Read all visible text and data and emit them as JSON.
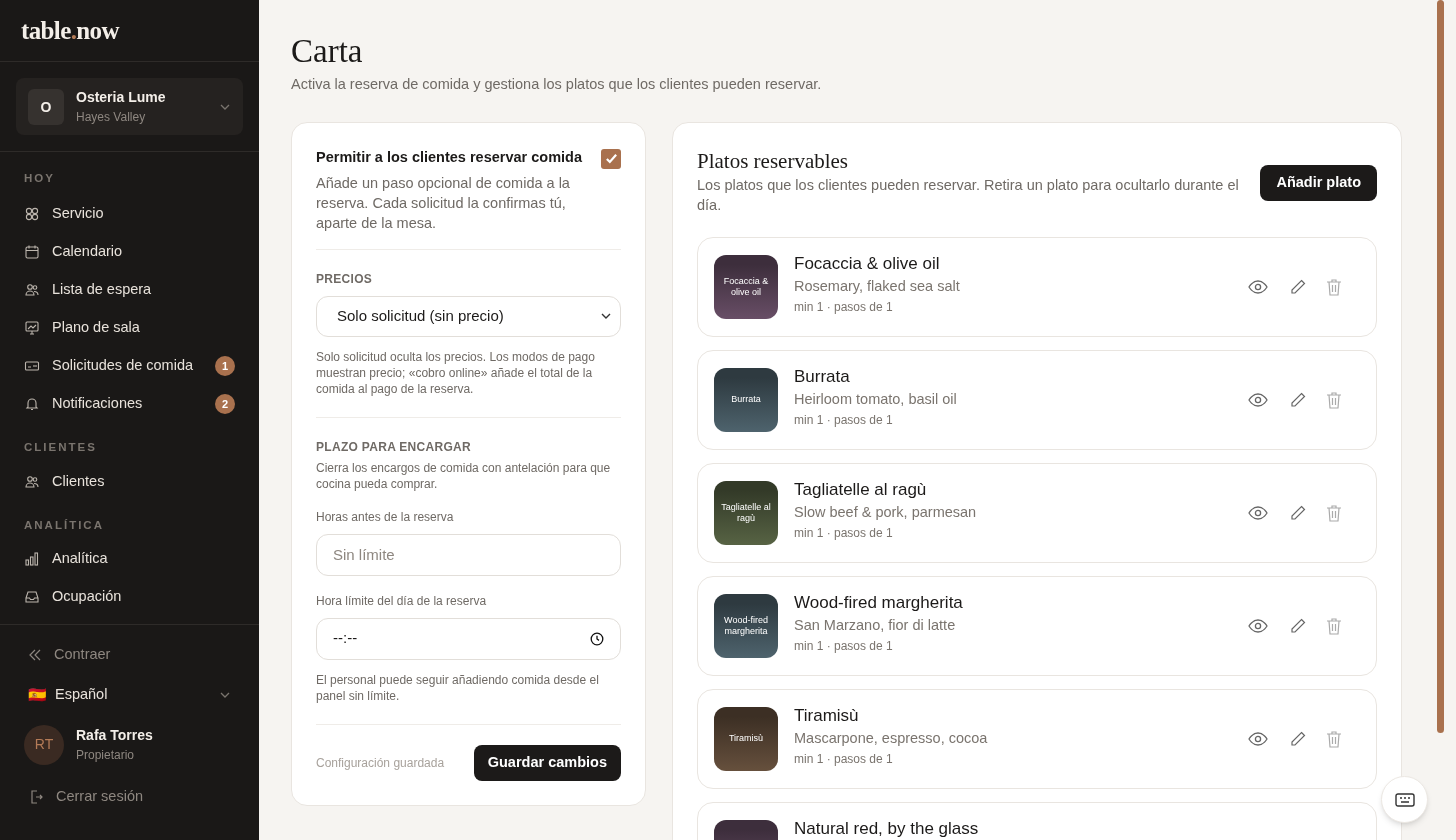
{
  "logo": {
    "name": "table",
    "separator": ".",
    "suffix": "now"
  },
  "venue": {
    "initial": "O",
    "name": "Osteria Lume",
    "area": "Hayes Valley"
  },
  "nav_sections": [
    {
      "heading": "HOY",
      "items": [
        {
          "label": "Servicio",
          "selected": false
        },
        {
          "label": "Calendario",
          "selected": false
        },
        {
          "label": "Lista de espera",
          "selected": false
        },
        {
          "label": "Plano de sala",
          "selected": false
        },
        {
          "label": "Solicitudes de comida",
          "selected": false,
          "badge": "1"
        },
        {
          "label": "Notificaciones",
          "selected": false,
          "badge": "2"
        }
      ]
    },
    {
      "heading": "CLIENTES",
      "items": [
        {
          "label": "Clientes",
          "selected": false
        }
      ]
    },
    {
      "heading": "ANALÍTICA",
      "items": [
        {
          "label": "Analítica",
          "selected": false
        },
        {
          "label": "Ocupación",
          "selected": false
        }
      ]
    }
  ],
  "collapse": "Contraer",
  "language": {
    "flag": "🇪🇸",
    "label": "Español"
  },
  "user": {
    "initials": "RT",
    "name": "Rafa Torres",
    "role": "Propietario"
  },
  "logout": "Cerrar sesión",
  "page": {
    "title": "Carta",
    "subtitle": "Activa la reserva de comida y gestiona los platos que los clientes pueden reservar."
  },
  "settings": {
    "toggle": {
      "label": "Permitir a los clientes reservar comida",
      "description": "Añade un paso opcional de comida a la reserva. Cada solicitud la confirmas tú, aparte de la mesa.",
      "checked": true
    },
    "pricing": {
      "heading": "PRECIOS",
      "value": "Solo solicitud (sin precio)",
      "help": "Solo solicitud oculta los precios. Los modos de pago muestran precio; «cobro online» añade el total de la comida al pago de la reserva."
    },
    "deadline": {
      "heading": "PLAZO PARA ENCARGAR",
      "description": "Cierra los encargos de comida con antelación para que cocina pueda comprar.",
      "hours_label": "Horas antes de la reserva",
      "hours_placeholder": "Sin límite",
      "time_label": "Hora límite del día de la reserva",
      "time_value": "--:--",
      "help": "El personal puede seguir añadiendo comida desde el panel sin límite."
    },
    "status": "Configuración guardada",
    "save": "Guardar cambios"
  },
  "dishes": {
    "title": "Platos reservables",
    "description": "Los platos que los clientes pueden reservar. Retira un plato para ocultarlo durante el día.",
    "add": "Añadir plato",
    "items": [
      {
        "name": "Focaccia & olive oil",
        "thumb_label": "Focaccia & olive oil",
        "details": "Rosemary, flaked sea salt",
        "meta": "min 1 · pasos de 1",
        "color": "#3d2e3c"
      },
      {
        "name": "Burrata",
        "thumb_label": "Burrata",
        "details": "Heirloom tomato, basil oil",
        "meta": "min 1 · pasos de 1",
        "color": "#2e3a40"
      },
      {
        "name": "Tagliatelle al ragù",
        "thumb_label": "Tagliatelle al ragù",
        "details": "Slow beef & pork, parmesan",
        "meta": "min 1 · pasos de 1",
        "color": "#333a28"
      },
      {
        "name": "Wood-fired margherita",
        "thumb_label": "Wood-fired margherita",
        "details": "San Marzano, fior di latte",
        "meta": "min 1 · pasos de 1",
        "color": "#2e3a40"
      },
      {
        "name": "Tiramisù",
        "thumb_label": "Tiramisù",
        "details": "Mascarpone, espresso, cocoa",
        "meta": "min 1 · pasos de 1",
        "color": "#3c2f24"
      },
      {
        "name": "Natural red, by the glass",
        "color": "#3d2e3c"
      }
    ]
  }
}
